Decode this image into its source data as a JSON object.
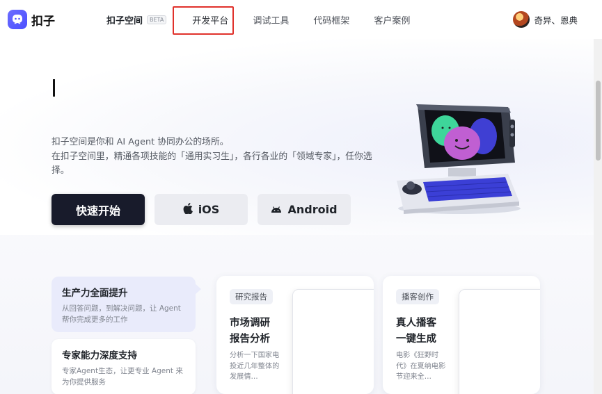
{
  "header": {
    "logo_text": "扣子",
    "nav": {
      "brand": "扣子空间",
      "badge": "BETA",
      "items": [
        "开发平台",
        "调试工具",
        "代码框架",
        "客户案例"
      ]
    },
    "user_name": "奇异、恩典"
  },
  "hero": {
    "line1": "扣子空间是你和 AI Agent 协同办公的场所。",
    "line2": "在扣子空间里，精通各项技能的「通用实习生」，各行各业的「领域专家」，任你选择。",
    "buttons": {
      "start": "快速开始",
      "ios": "iOS",
      "android": "Android"
    }
  },
  "features": [
    {
      "title": "生产力全面提升",
      "desc": "从回答问题，到解决问题，让 Agent 帮你完成更多的工作"
    },
    {
      "title": "专家能力深度支持",
      "desc": "专家Agent生态，让更专业 Agent 来为你提供服务"
    }
  ],
  "cards": [
    {
      "tag": "研究报告",
      "title": "市场调研报告分析",
      "desc": "分析一下国家电投近几年整体的发展情…"
    },
    {
      "tag": "播客创作",
      "title": "真人播客一键生成",
      "desc": "电影《狂野时代》在夏纳电影节迎来全…"
    }
  ],
  "colors": {
    "primary_button": "#181b2b",
    "highlight_box": "#e0312b",
    "feature_active_bg": "#e9ebfb"
  }
}
